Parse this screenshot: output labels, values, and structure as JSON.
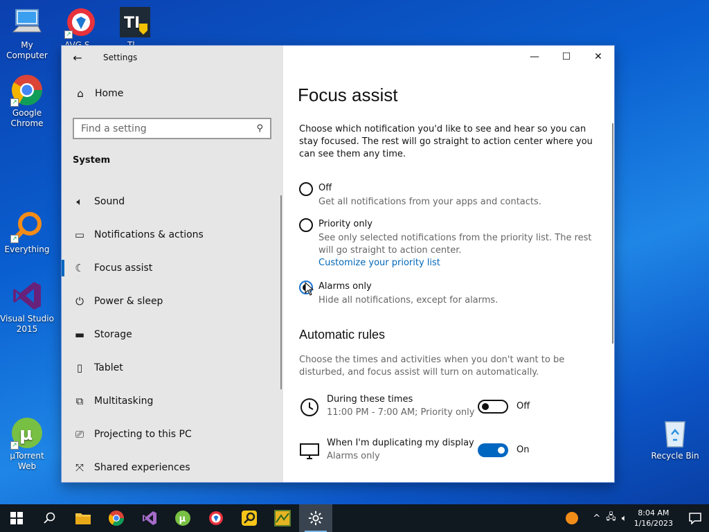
{
  "desktop": {
    "icons": [
      {
        "label": "My Computer"
      },
      {
        "label": "AVG S..."
      },
      {
        "label": "Tl..."
      },
      {
        "label": "Google Chrome"
      },
      {
        "label": "Everything"
      },
      {
        "label": "Visual Studio 2015"
      },
      {
        "label": "µTorrent Web"
      },
      {
        "label": "Recycle Bin"
      }
    ]
  },
  "window": {
    "title": "Settings",
    "home_label": "Home",
    "search_placeholder": "Find a setting",
    "section_label": "System",
    "nav": [
      {
        "label": "Sound",
        "icon": "speaker-icon"
      },
      {
        "label": "Notifications & actions",
        "icon": "notification-icon"
      },
      {
        "label": "Focus assist",
        "icon": "moon-icon",
        "active": true
      },
      {
        "label": "Power & sleep",
        "icon": "power-icon"
      },
      {
        "label": "Storage",
        "icon": "storage-icon"
      },
      {
        "label": "Tablet",
        "icon": "tablet-icon"
      },
      {
        "label": "Multitasking",
        "icon": "multitasking-icon"
      },
      {
        "label": "Projecting to this PC",
        "icon": "projector-icon"
      },
      {
        "label": "Shared experiences",
        "icon": "shared-icon"
      }
    ]
  },
  "content": {
    "title": "Focus assist",
    "intro": "Choose which notification you'd like to see and hear so you can stay focused. The rest will go straight to action center where you can see them any time.",
    "options": [
      {
        "label": "Off",
        "desc": "Get all notifications from your apps and contacts.",
        "selected": false
      },
      {
        "label": "Priority only",
        "desc": "See only selected notifications from the priority list. The rest will go straight to action center.",
        "link": "Customize your priority list",
        "selected": false
      },
      {
        "label": "Alarms only",
        "desc": "Hide all notifications, except for alarms.",
        "selected": true
      }
    ],
    "rules_heading": "Automatic rules",
    "rules_desc": "Choose the times and activities when you don't want to be disturbed, and focus assist will turn on automatically.",
    "rules": [
      {
        "label": "During these times",
        "sub": "11:00 PM - 7:00 AM; Priority only",
        "state": "Off"
      },
      {
        "label": "When I'm duplicating my display",
        "sub": "Alarms only",
        "state": "On"
      }
    ]
  },
  "taskbar": {
    "time": "8:04 AM",
    "date": "1/16/2023"
  },
  "colors": {
    "accent": "#0067c0",
    "link": "#0067b8",
    "taskbar": "#101820"
  }
}
